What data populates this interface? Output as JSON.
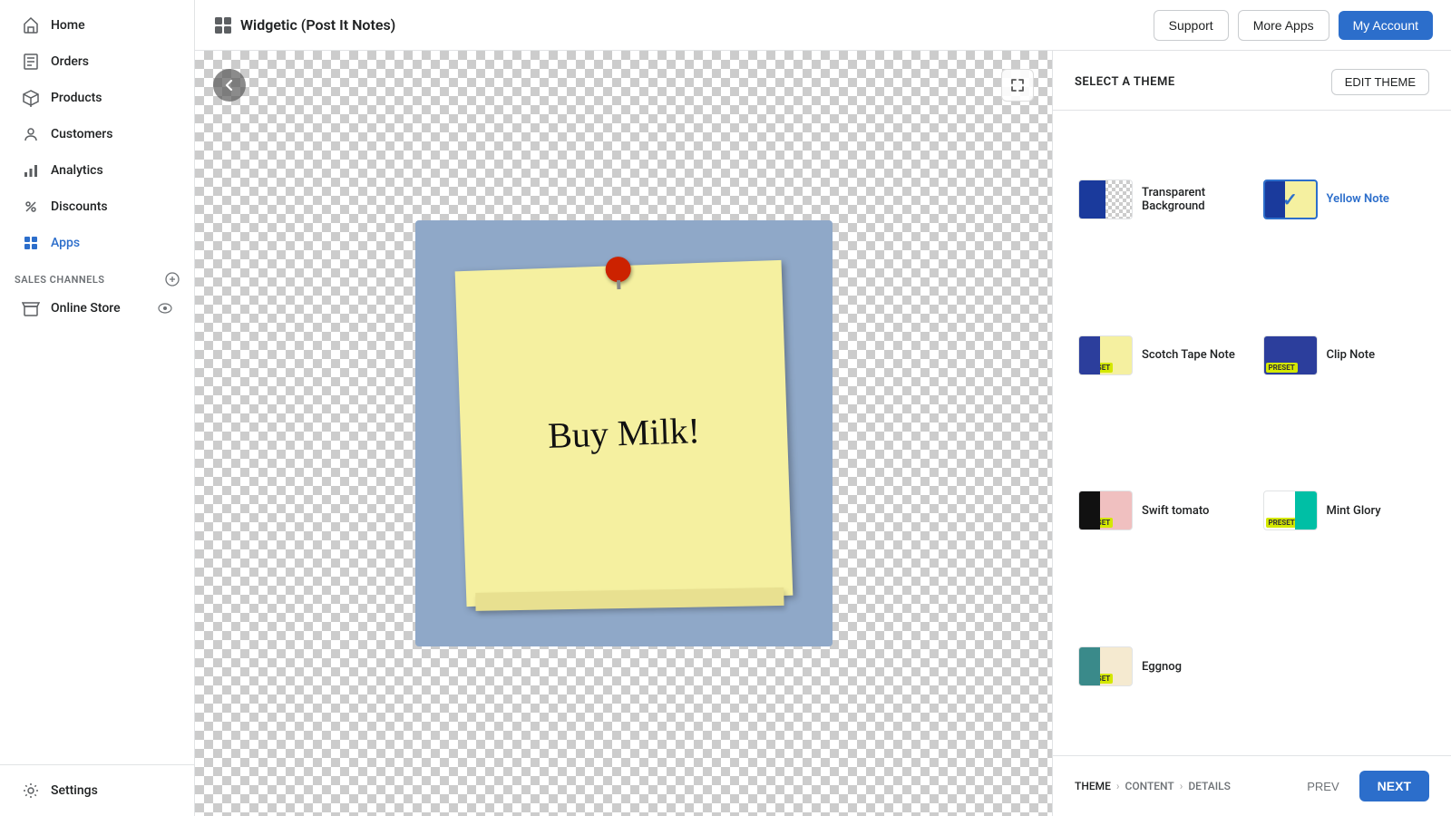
{
  "app": {
    "title": "Widgetic (Post It Notes)"
  },
  "topbar": {
    "support_label": "Support",
    "more_apps_label": "More Apps",
    "my_account_label": "My Account"
  },
  "sidebar": {
    "nav_items": [
      {
        "id": "home",
        "label": "Home",
        "icon": "home"
      },
      {
        "id": "orders",
        "label": "Orders",
        "icon": "orders"
      },
      {
        "id": "products",
        "label": "Products",
        "icon": "products"
      },
      {
        "id": "customers",
        "label": "Customers",
        "icon": "customers"
      },
      {
        "id": "analytics",
        "label": "Analytics",
        "icon": "analytics"
      },
      {
        "id": "discounts",
        "label": "Discounts",
        "icon": "discounts"
      },
      {
        "id": "apps",
        "label": "Apps",
        "icon": "apps",
        "active": true
      }
    ],
    "sales_channels_label": "SALES CHANNELS",
    "sales_channels": [
      {
        "id": "online-store",
        "label": "Online Store",
        "icon": "store"
      }
    ],
    "settings_label": "Settings"
  },
  "preview": {
    "note_text": "Buy Milk!",
    "back_title": "Back"
  },
  "panel": {
    "select_theme_label": "SELECT A THEME",
    "edit_theme_label": "EDIT THEME",
    "themes": [
      {
        "id": "transparent-background",
        "label": "Transparent Background",
        "swatch": "transparent",
        "selected": false,
        "preset": false
      },
      {
        "id": "yellow-note",
        "label": "Yellow Note",
        "swatch": "yellow",
        "selected": true,
        "preset": false
      },
      {
        "id": "scotch-tape-note",
        "label": "Scotch Tape Note",
        "swatch": "scotch",
        "selected": false,
        "preset": true
      },
      {
        "id": "clip-note",
        "label": "Clip Note",
        "swatch": "clip",
        "selected": false,
        "preset": true
      },
      {
        "id": "swift-tomato",
        "label": "Swift tomato",
        "swatch": "swift",
        "selected": false,
        "preset": true
      },
      {
        "id": "mint-glory",
        "label": "Mint Glory",
        "swatch": "mint",
        "selected": false,
        "preset": true
      },
      {
        "id": "eggnog",
        "label": "Eggnog",
        "swatch": "eggnog",
        "selected": false,
        "preset": true
      }
    ],
    "breadcrumb": {
      "steps": [
        {
          "id": "theme",
          "label": "THEME",
          "active": true
        },
        {
          "id": "content",
          "label": "CONTENT",
          "active": false
        },
        {
          "id": "details",
          "label": "DETAILS",
          "active": false
        }
      ]
    },
    "prev_label": "PREV",
    "next_label": "NEXT"
  }
}
